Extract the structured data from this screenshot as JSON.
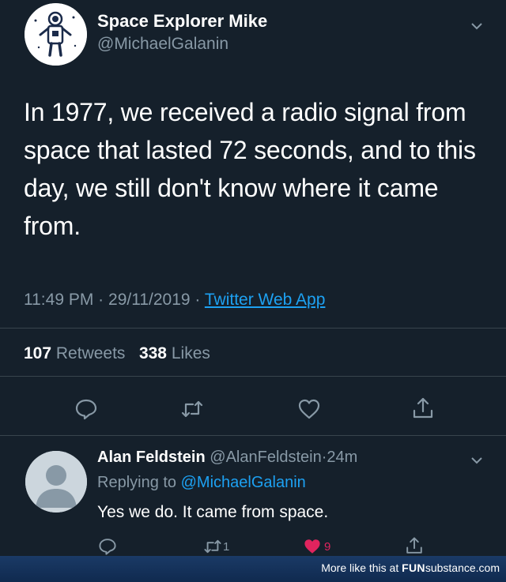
{
  "tweet": {
    "display_name": "Space Explorer Mike",
    "handle": "@MichaelGalanin",
    "text": "In 1977, we received a radio signal from space that lasted 72 seconds, and to this day, we still don't know where it came from.",
    "time": "11:49 PM",
    "sep1": "·",
    "date": "29/11/2019",
    "sep2": "·",
    "source": "Twitter Web App",
    "retweets_count": "107",
    "retweets_label": "Retweets",
    "likes_count": "338",
    "likes_label": "Likes"
  },
  "reply": {
    "display_name": "Alan Feldstein",
    "handle": "@AlanFeldstein",
    "sep": "·",
    "age": "24m",
    "replying_label": "Replying to",
    "replying_handle": "@MichaelGalanin",
    "text": "Yes we do. It came from space.",
    "retweet_count": "1",
    "like_count": "9"
  },
  "footer": {
    "prefix": "More like this at",
    "brand_a": "FUN",
    "brand_b": "substance",
    "brand_c": ".com"
  },
  "colors": {
    "background": "#15202b",
    "secondary_text": "#8899a6",
    "link": "#1da1f2",
    "like_active": "#e0245e"
  },
  "icons": [
    "astronaut-avatar",
    "chevron-down-icon",
    "reply-icon",
    "retweet-icon",
    "heart-icon",
    "share-icon",
    "default-avatar"
  ]
}
